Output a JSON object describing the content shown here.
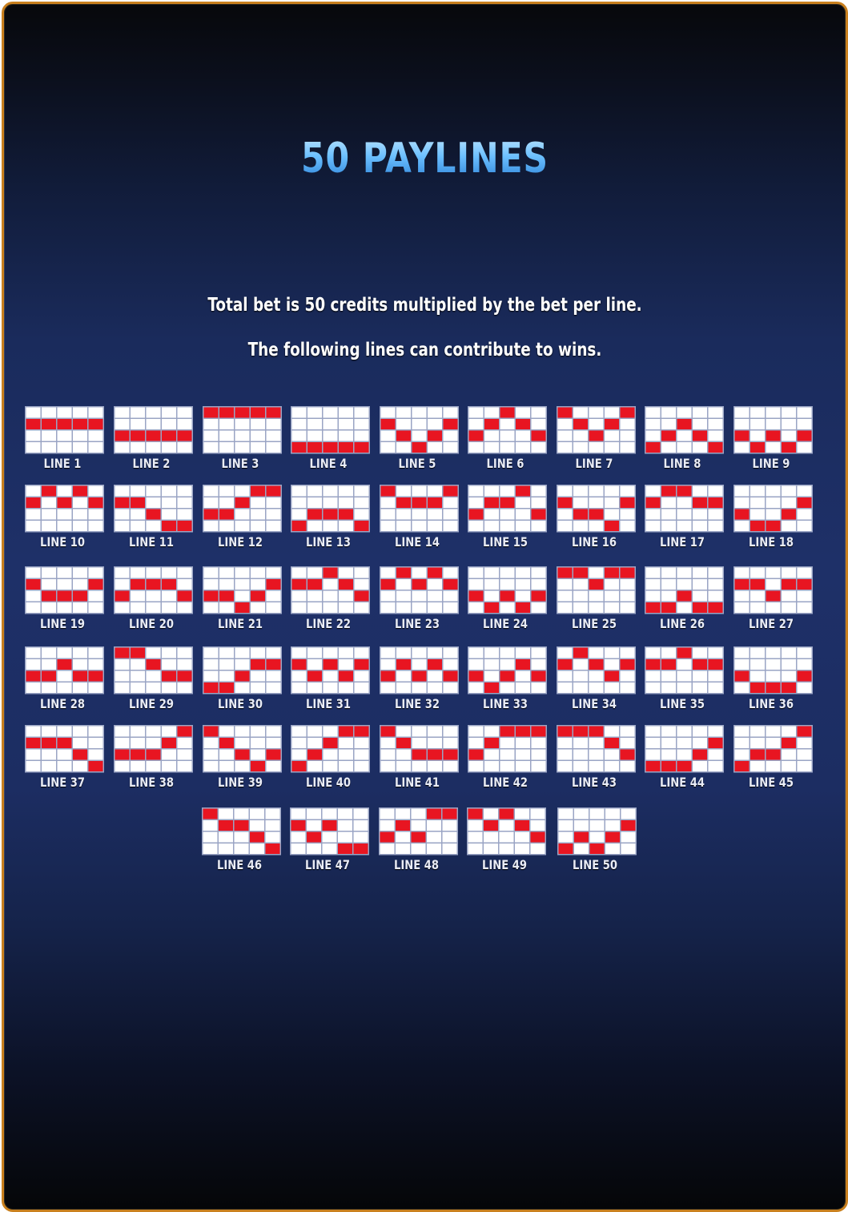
{
  "title": "50 PAYLINES",
  "description": {
    "line1": "Total bet is 50 credits multiplied by the bet per line.",
    "line2": "The following lines can contribute to wins."
  },
  "colors": {
    "active_cell": "#e81521",
    "inactive_cell": "#ffffff",
    "title": "#4aa8f0",
    "frame_border": "#c9801e"
  },
  "grid": {
    "reels": 5,
    "rows": 4
  },
  "paylines": [
    {
      "label": "LINE 1",
      "rows": [
        1,
        1,
        1,
        1,
        1
      ]
    },
    {
      "label": "LINE 2",
      "rows": [
        2,
        2,
        2,
        2,
        2
      ]
    },
    {
      "label": "LINE 3",
      "rows": [
        0,
        0,
        0,
        0,
        0
      ]
    },
    {
      "label": "LINE 4",
      "rows": [
        3,
        3,
        3,
        3,
        3
      ]
    },
    {
      "label": "LINE 5",
      "rows": [
        1,
        2,
        3,
        2,
        1
      ]
    },
    {
      "label": "LINE 6",
      "rows": [
        2,
        1,
        0,
        1,
        2
      ]
    },
    {
      "label": "LINE 7",
      "rows": [
        0,
        1,
        2,
        1,
        0
      ]
    },
    {
      "label": "LINE 8",
      "rows": [
        3,
        2,
        1,
        2,
        3
      ]
    },
    {
      "label": "LINE 9",
      "rows": [
        2,
        3,
        2,
        3,
        2
      ]
    },
    {
      "label": "LINE 10",
      "rows": [
        1,
        0,
        1,
        0,
        1
      ]
    },
    {
      "label": "LINE 11",
      "rows": [
        1,
        1,
        2,
        3,
        3
      ]
    },
    {
      "label": "LINE 12",
      "rows": [
        2,
        2,
        1,
        0,
        0
      ]
    },
    {
      "label": "LINE 13",
      "rows": [
        3,
        2,
        2,
        2,
        3
      ]
    },
    {
      "label": "LINE 14",
      "rows": [
        0,
        1,
        1,
        1,
        0
      ]
    },
    {
      "label": "LINE 15",
      "rows": [
        2,
        1,
        1,
        0,
        2
      ]
    },
    {
      "label": "LINE 16",
      "rows": [
        1,
        2,
        2,
        3,
        1
      ]
    },
    {
      "label": "LINE 17",
      "rows": [
        1,
        0,
        0,
        1,
        1
      ]
    },
    {
      "label": "LINE 18",
      "rows": [
        2,
        3,
        3,
        2,
        1
      ]
    },
    {
      "label": "LINE 19",
      "rows": [
        1,
        2,
        2,
        2,
        1
      ]
    },
    {
      "label": "LINE 20",
      "rows": [
        2,
        1,
        1,
        1,
        2
      ]
    },
    {
      "label": "LINE 21",
      "rows": [
        2,
        2,
        3,
        2,
        1
      ]
    },
    {
      "label": "LINE 22",
      "rows": [
        1,
        1,
        0,
        1,
        2
      ]
    },
    {
      "label": "LINE 23",
      "rows": [
        1,
        0,
        1,
        0,
        1
      ]
    },
    {
      "label": "LINE 24",
      "rows": [
        2,
        3,
        2,
        3,
        2
      ]
    },
    {
      "label": "LINE 25",
      "rows": [
        0,
        0,
        1,
        0,
        0
      ]
    },
    {
      "label": "LINE 26",
      "rows": [
        3,
        3,
        2,
        3,
        3
      ]
    },
    {
      "label": "LINE 27",
      "rows": [
        1,
        1,
        2,
        1,
        1
      ]
    },
    {
      "label": "LINE 28",
      "rows": [
        2,
        2,
        1,
        2,
        2
      ]
    },
    {
      "label": "LINE 29",
      "rows": [
        0,
        0,
        1,
        2,
        2
      ]
    },
    {
      "label": "LINE 30",
      "rows": [
        3,
        3,
        2,
        1,
        1
      ]
    },
    {
      "label": "LINE 31",
      "rows": [
        1,
        2,
        1,
        2,
        1
      ]
    },
    {
      "label": "LINE 32",
      "rows": [
        2,
        1,
        2,
        1,
        2
      ]
    },
    {
      "label": "LINE 33",
      "rows": [
        2,
        3,
        2,
        1,
        2
      ]
    },
    {
      "label": "LINE 34",
      "rows": [
        1,
        0,
        1,
        2,
        1
      ]
    },
    {
      "label": "LINE 35",
      "rows": [
        1,
        1,
        0,
        1,
        1
      ]
    },
    {
      "label": "LINE 36",
      "rows": [
        2,
        3,
        3,
        3,
        2
      ]
    },
    {
      "label": "LINE 37",
      "rows": [
        1,
        1,
        1,
        2,
        3
      ]
    },
    {
      "label": "LINE 38",
      "rows": [
        2,
        2,
        2,
        1,
        0
      ]
    },
    {
      "label": "LINE 39",
      "rows": [
        0,
        1,
        2,
        3,
        2
      ]
    },
    {
      "label": "LINE 40",
      "rows": [
        3,
        2,
        1,
        0,
        0
      ]
    },
    {
      "label": "LINE 41",
      "rows": [
        0,
        1,
        2,
        2,
        2
      ]
    },
    {
      "label": "LINE 42",
      "rows": [
        2,
        1,
        0,
        0,
        0
      ]
    },
    {
      "label": "LINE 43",
      "rows": [
        0,
        0,
        0,
        1,
        2
      ]
    },
    {
      "label": "LINE 44",
      "rows": [
        3,
        3,
        3,
        2,
        1
      ]
    },
    {
      "label": "LINE 45",
      "rows": [
        3,
        2,
        2,
        1,
        0
      ]
    },
    {
      "label": "LINE 46",
      "rows": [
        0,
        1,
        1,
        2,
        3
      ]
    },
    {
      "label": "LINE 47",
      "rows": [
        1,
        2,
        1,
        3,
        3
      ]
    },
    {
      "label": "LINE 48",
      "rows": [
        2,
        1,
        2,
        0,
        0
      ]
    },
    {
      "label": "LINE 49",
      "rows": [
        0,
        1,
        0,
        1,
        2
      ]
    },
    {
      "label": "LINE 50",
      "rows": [
        3,
        2,
        3,
        2,
        1
      ]
    }
  ]
}
